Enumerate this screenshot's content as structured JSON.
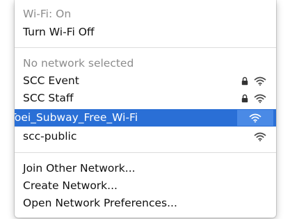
{
  "wifi_menu": {
    "status": "Wi-Fi: On",
    "toggle_label": "Turn Wi-Fi Off",
    "no_network_label": "No network selected",
    "networks": [
      {
        "name": "SCC Event",
        "locked": true,
        "icon": "wifi-icon"
      },
      {
        "name": "SCC Staff",
        "locked": true,
        "icon": "wifi-icon"
      },
      {
        "name": "Toei_Subway_Free_Wi-Fi",
        "locked": false,
        "selected": true,
        "icon": "wifi-icon"
      },
      {
        "name": "scc-public",
        "locked": false,
        "icon": "wifi-icon"
      }
    ],
    "actions": {
      "join_other": "Join Other Network...",
      "create": "Create Network...",
      "open_prefs": "Open Network Preferences..."
    }
  },
  "colors": {
    "selection": "#2a6fd6",
    "dim_text": "#8c8c8c",
    "text": "#111111"
  }
}
